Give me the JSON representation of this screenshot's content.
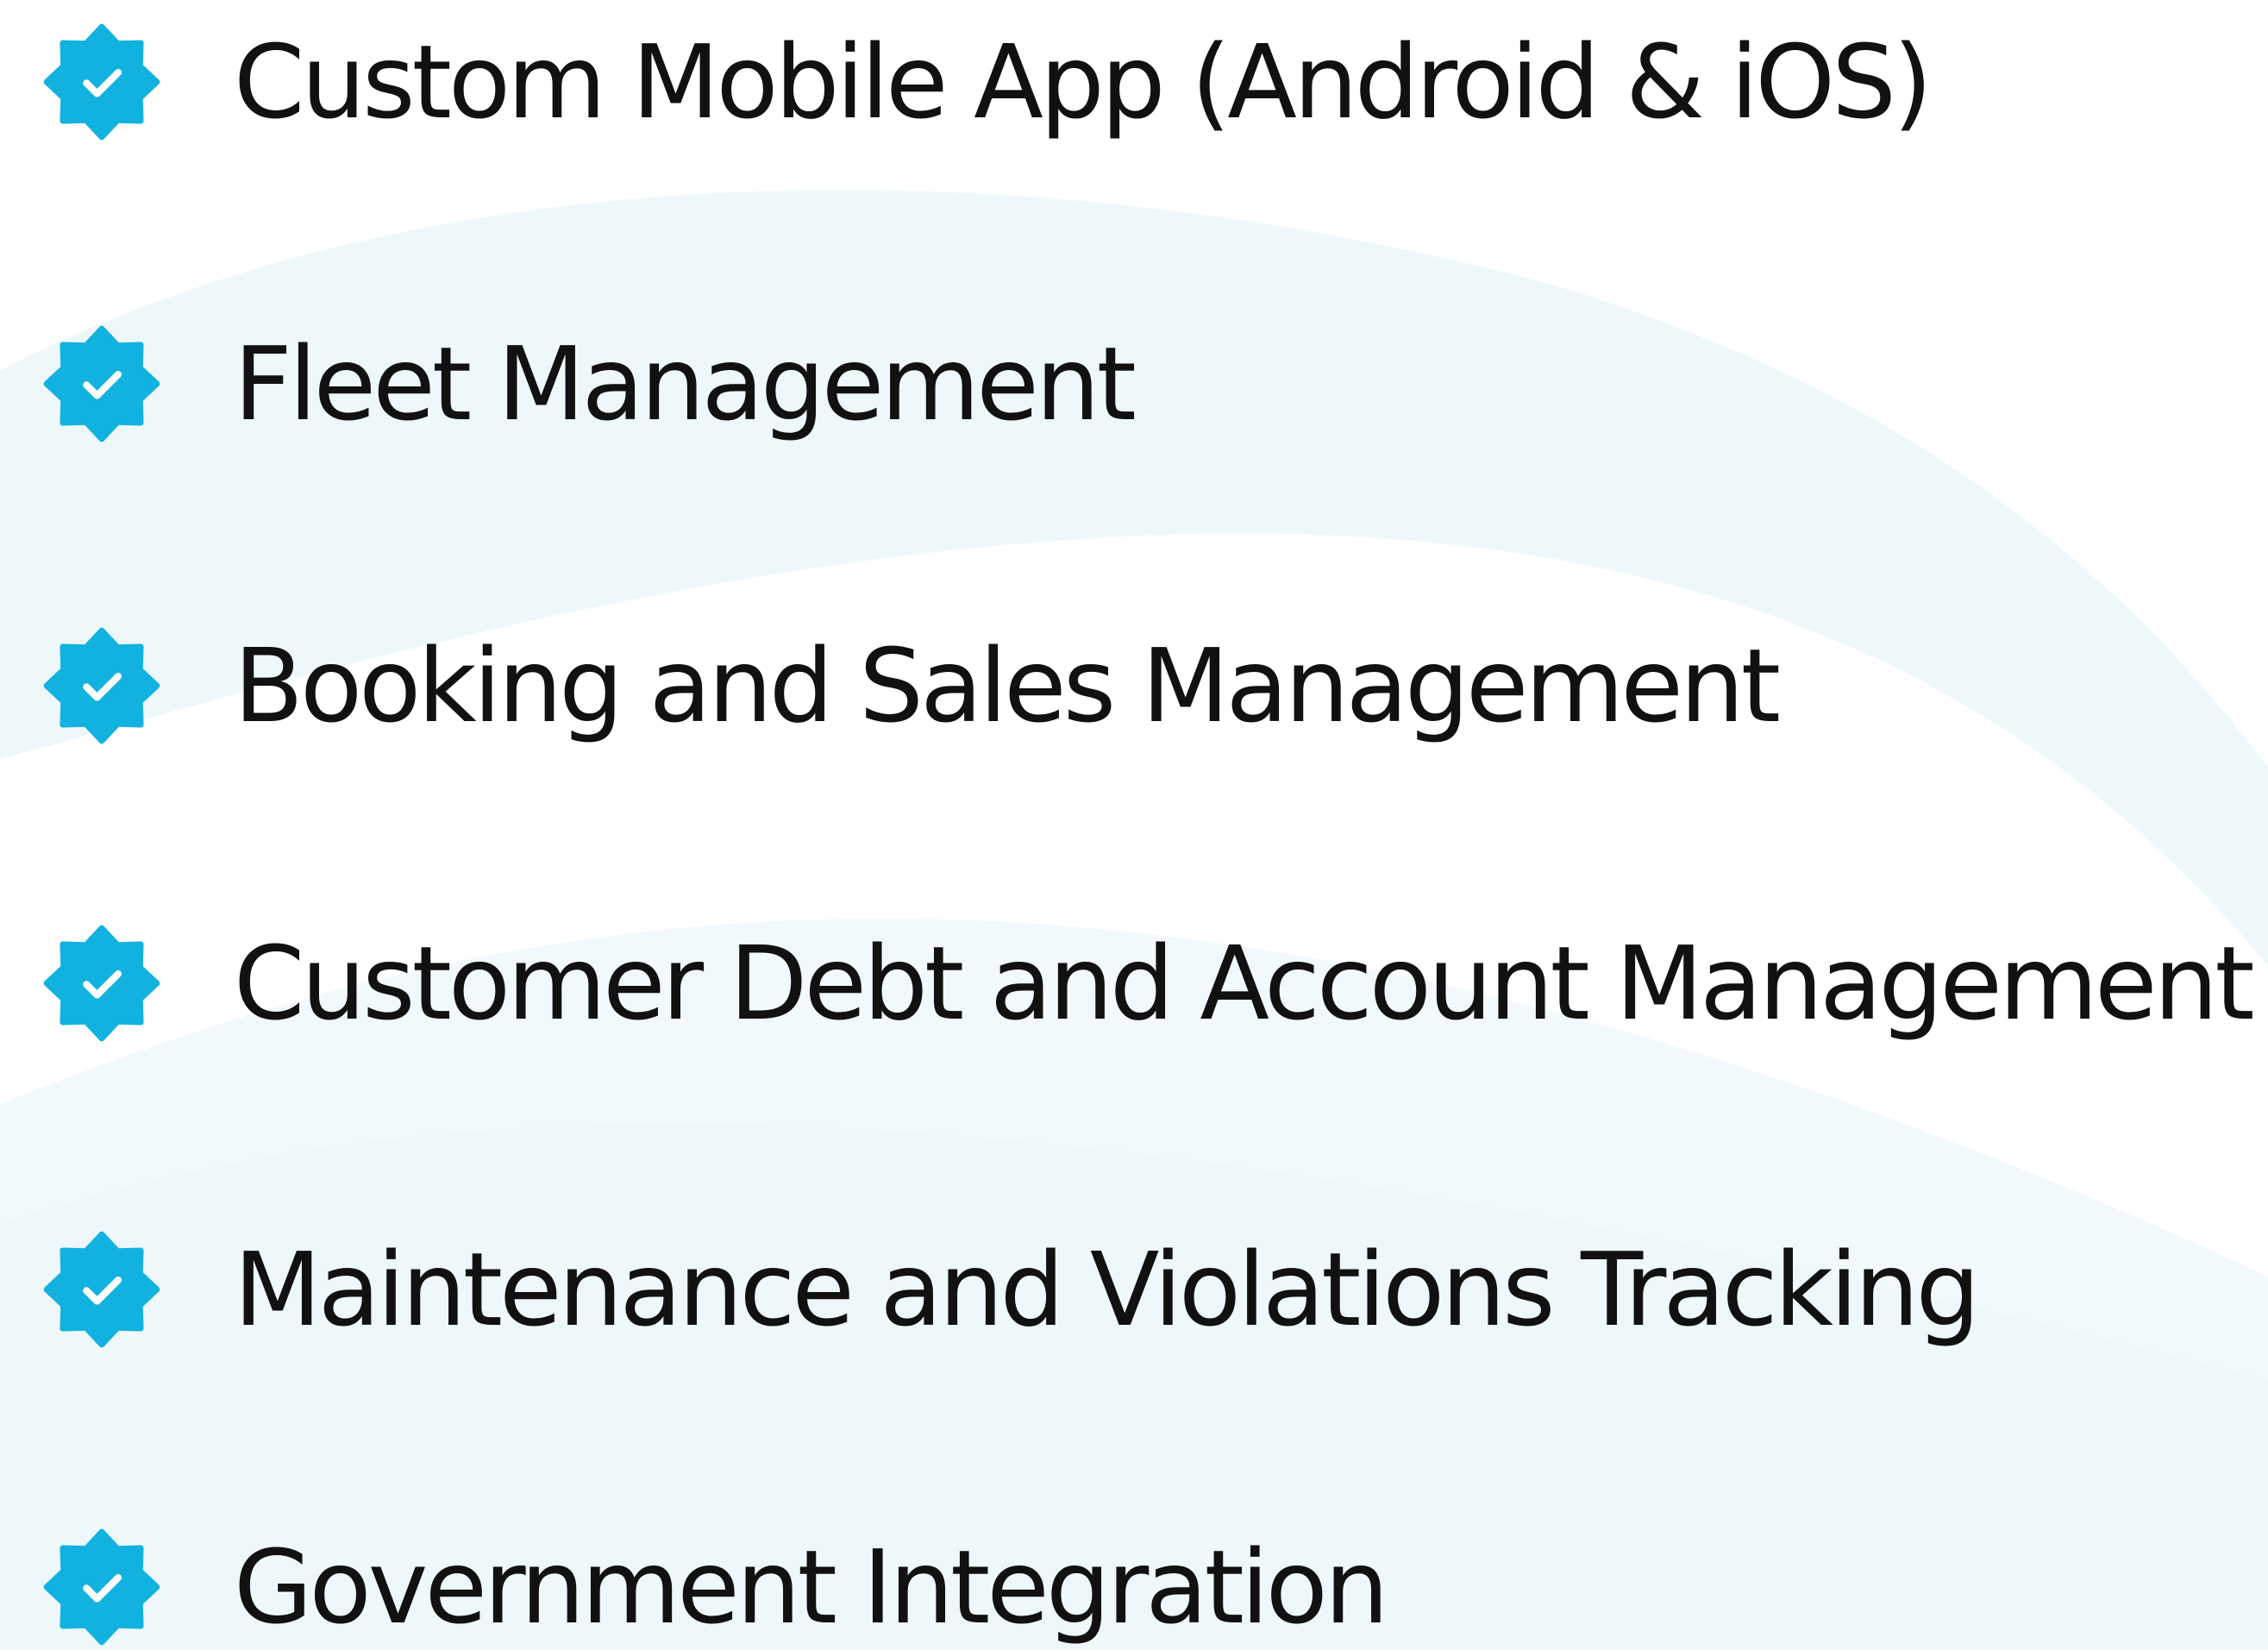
{
  "colors": {
    "accent": "#12b2e0",
    "text": "#111111",
    "background_swoosh": "#eef8fb"
  },
  "features": [
    {
      "label": "Custom Mobile App (Android & iOS)",
      "icon": "check-badge-icon"
    },
    {
      "label": "Fleet Management",
      "icon": "check-badge-icon"
    },
    {
      "label": "Booking and Sales Management",
      "icon": "check-badge-icon"
    },
    {
      "label": "Customer Debt and Account Management",
      "icon": "check-badge-icon"
    },
    {
      "label": "Maintenance and Violations Tracking",
      "icon": "check-badge-icon"
    },
    {
      "label": "Government Integration",
      "icon": "check-badge-icon"
    }
  ]
}
